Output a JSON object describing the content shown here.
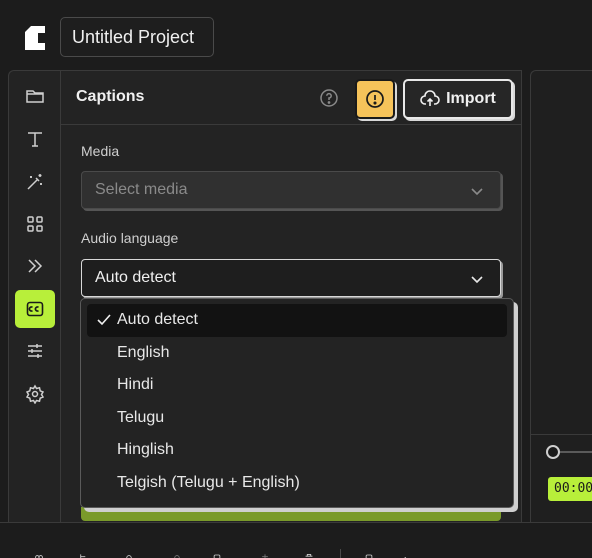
{
  "app": {
    "project_title": "Untitled Project"
  },
  "sidebar": {
    "items": [
      {
        "icon": "folder-icon",
        "active": false
      },
      {
        "icon": "text-icon",
        "active": false
      },
      {
        "icon": "magic-wand-icon",
        "active": false
      },
      {
        "icon": "grid-icon",
        "active": false
      },
      {
        "icon": "transitions-icon",
        "active": false
      },
      {
        "icon": "captions-icon",
        "active": true
      },
      {
        "icon": "adjustments-icon",
        "active": false
      },
      {
        "icon": "settings-icon",
        "active": false
      }
    ]
  },
  "captions_panel": {
    "title": "Captions",
    "import_label": "Import",
    "media": {
      "label": "Media",
      "placeholder": "Select media"
    },
    "audio_language": {
      "label": "Audio language",
      "value": "Auto detect",
      "options": [
        "Auto detect",
        "English",
        "Hindi",
        "Telugu",
        "Hinglish",
        "Telgish (Telugu + English)"
      ],
      "selected_index": 0
    }
  },
  "timeline": {
    "timecode": "00:00"
  },
  "colors": {
    "accent": "#b8ef3a",
    "warning": "#f6c35a",
    "background": "#1c1c1c",
    "panel": "#232323"
  }
}
